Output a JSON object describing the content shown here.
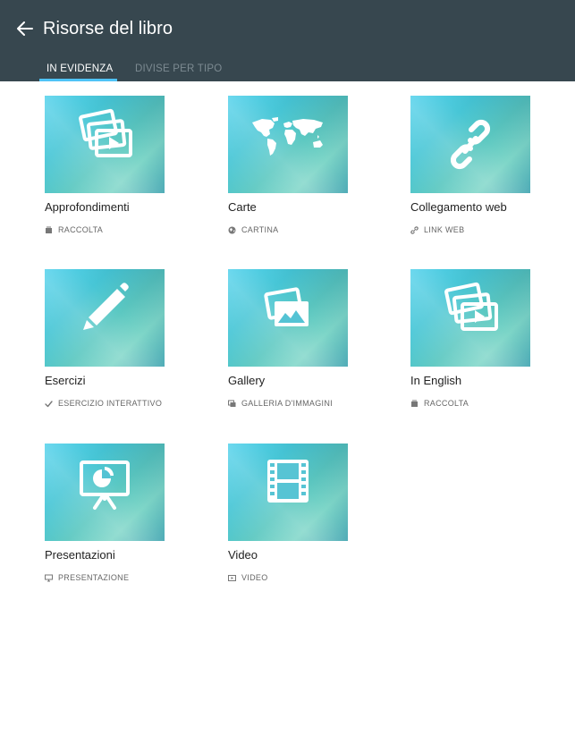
{
  "header": {
    "title": "Risorse del libro",
    "back_icon": "arrow-left-icon",
    "background": "#37474f"
  },
  "tabs": [
    {
      "label": "IN EVIDENZA",
      "active": true
    },
    {
      "label": "DIVISE PER TIPO",
      "active": false
    }
  ],
  "accent_color": "#4fc3f7",
  "resources": [
    {
      "title": "Approfondimenti",
      "type": "RACCOLTA",
      "thumb_icon": "slides-video-icon",
      "type_icon": "collection-icon"
    },
    {
      "title": "Carte",
      "type": "CARTINA",
      "thumb_icon": "world-map-icon",
      "type_icon": "globe-icon"
    },
    {
      "title": "Collegamento web",
      "type": "LINK WEB",
      "thumb_icon": "chain-link-icon",
      "type_icon": "link-icon"
    },
    {
      "title": "Esercizi",
      "type": "ESERCIZIO INTERATTIVO",
      "thumb_icon": "pencil-icon",
      "type_icon": "checkmark-icon"
    },
    {
      "title": "Gallery",
      "type": "GALLERIA D'IMMAGINI",
      "thumb_icon": "photo-stack-icon",
      "type_icon": "gallery-icon"
    },
    {
      "title": "In English",
      "type": "RACCOLTA",
      "thumb_icon": "slides-video-icon",
      "type_icon": "collection-icon"
    },
    {
      "title": "Presentazioni",
      "type": "PRESENTAZIONE",
      "thumb_icon": "presentation-board-icon",
      "type_icon": "presentation-icon"
    },
    {
      "title": "Video",
      "type": "VIDEO",
      "thumb_icon": "film-strip-icon",
      "type_icon": "video-icon"
    }
  ]
}
